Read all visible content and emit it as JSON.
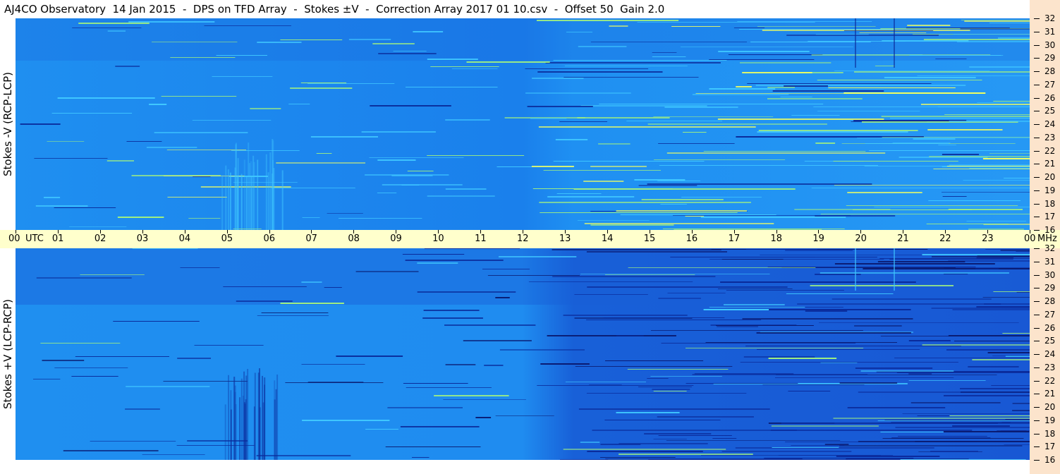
{
  "title": "AJ4CO Observatory  14 Jan 2015  -  DPS on TFD Array  -  Stokes ±V  -  Correction Array 2017 01 10.csv  -  Offset 50  Gain 2.0",
  "colors": {
    "background_light": "#1f8ff0",
    "background_dark": "#1860d8",
    "deep": "#0a2a9a",
    "bright": "#40c8ff",
    "green": "#a0f080",
    "yellow": "#f0ff60",
    "time_axis_bg": "#ffffcc",
    "side_strip_bg": "#fce4cc"
  },
  "chart_data": [
    {
      "type": "heatmap",
      "ylabel": "Stokes -V (RCP-LCP)",
      "ylim": [
        16,
        32
      ],
      "x_unit": "UTC",
      "y_unit": "MHz",
      "y_ticks": [
        16,
        17,
        18,
        19,
        20,
        21,
        22,
        23,
        24,
        25,
        26,
        27,
        28,
        29,
        30,
        31,
        32
      ]
    },
    {
      "type": "heatmap",
      "ylabel": "Stokes +V (LCP-RCP)",
      "ylim": [
        16,
        32
      ],
      "x_unit": "UTC",
      "y_unit": "MHz",
      "y_ticks": [
        16,
        17,
        18,
        19,
        20,
        21,
        22,
        23,
        24,
        25,
        26,
        27,
        28,
        29,
        30,
        31,
        32
      ]
    }
  ],
  "x_axis": {
    "tick_labels": [
      "00",
      "01",
      "02",
      "03",
      "04",
      "05",
      "06",
      "07",
      "08",
      "09",
      "10",
      "11",
      "12",
      "13",
      "14",
      "15",
      "16",
      "17",
      "18",
      "19",
      "20",
      "21",
      "22",
      "23",
      "00"
    ],
    "unit_label": "UTC",
    "freq_unit_label": "MHz"
  }
}
